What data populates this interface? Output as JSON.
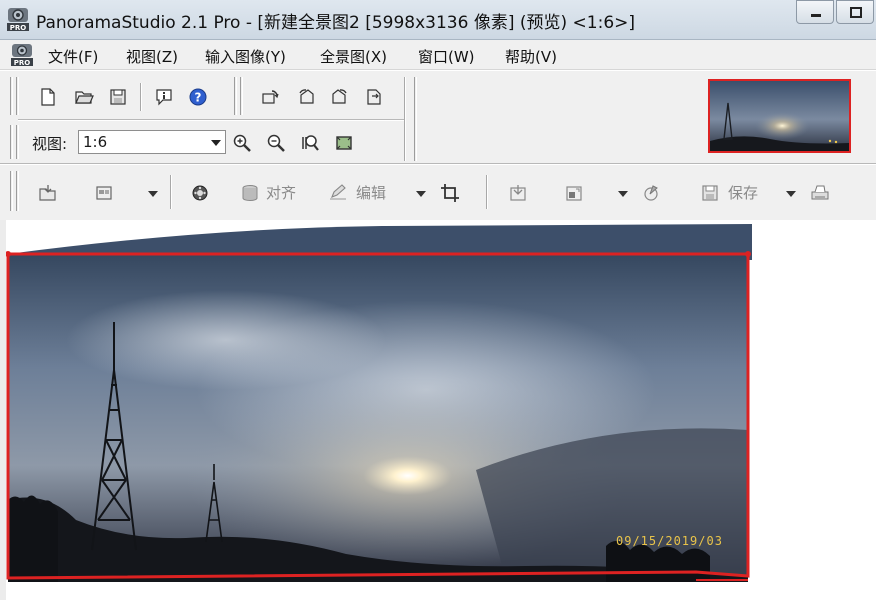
{
  "window": {
    "title": "PanoramaStudio 2.1 Pro - [新建全景图2 [5998x3136 像素] (预览) <1:6>]"
  },
  "menu": {
    "items": [
      {
        "label": "文件(F)"
      },
      {
        "label": "视图(Z)"
      },
      {
        "label": "输入图像(Y)"
      },
      {
        "label": "全景图(X)"
      },
      {
        "label": "窗口(W)"
      },
      {
        "label": "帮助(V)"
      }
    ]
  },
  "toolbar": {
    "view_label": "视图:",
    "zoom_value": "1:6",
    "align_label": "对齐",
    "edit_label": "编辑",
    "save_label": "保存"
  },
  "canvas": {
    "timestamp": "09/15/2019/03"
  },
  "colors": {
    "selection": "#dd2222",
    "titlebar": "#d4dde7",
    "toolbar_bg": "#f0f0f0"
  }
}
